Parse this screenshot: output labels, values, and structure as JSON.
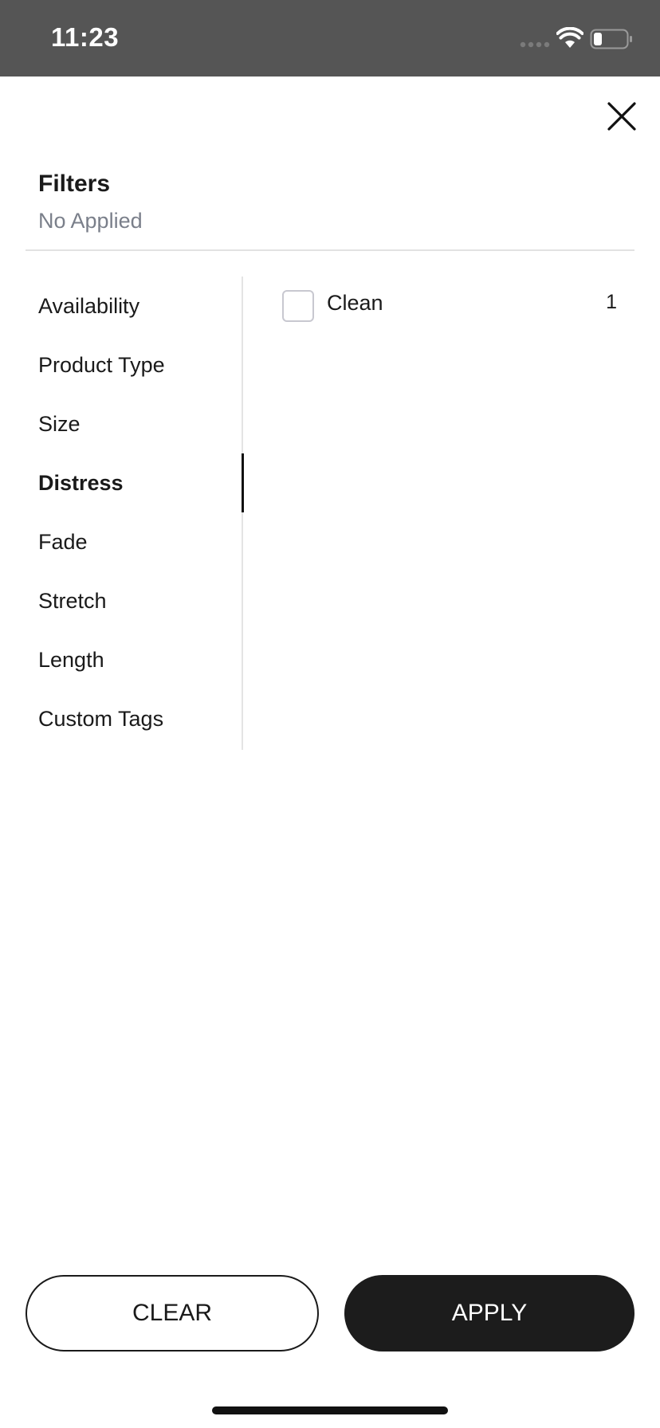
{
  "status_bar": {
    "time": "11:23",
    "icons": [
      "signal-icon",
      "wifi-icon",
      "battery-icon"
    ]
  },
  "header": {
    "close_icon": "close-icon",
    "title": "Filters",
    "subtitle": "No Applied"
  },
  "categories": {
    "active_index": 3,
    "items": [
      {
        "label": "Availability"
      },
      {
        "label": "Product Type"
      },
      {
        "label": "Size"
      },
      {
        "label": "Distress"
      },
      {
        "label": "Fade"
      },
      {
        "label": "Stretch"
      },
      {
        "label": "Length"
      },
      {
        "label": "Custom Tags"
      }
    ]
  },
  "options": {
    "items": [
      {
        "label": "Clean",
        "count": "1",
        "checked": false
      }
    ]
  },
  "footer": {
    "clear_label": "CLEAR",
    "apply_label": "APPLY"
  },
  "colors": {
    "status_bar_bg": "#555555",
    "accent": "#1c1c1c",
    "muted_text": "#7a7f8a",
    "divider": "#e2e2e2"
  }
}
